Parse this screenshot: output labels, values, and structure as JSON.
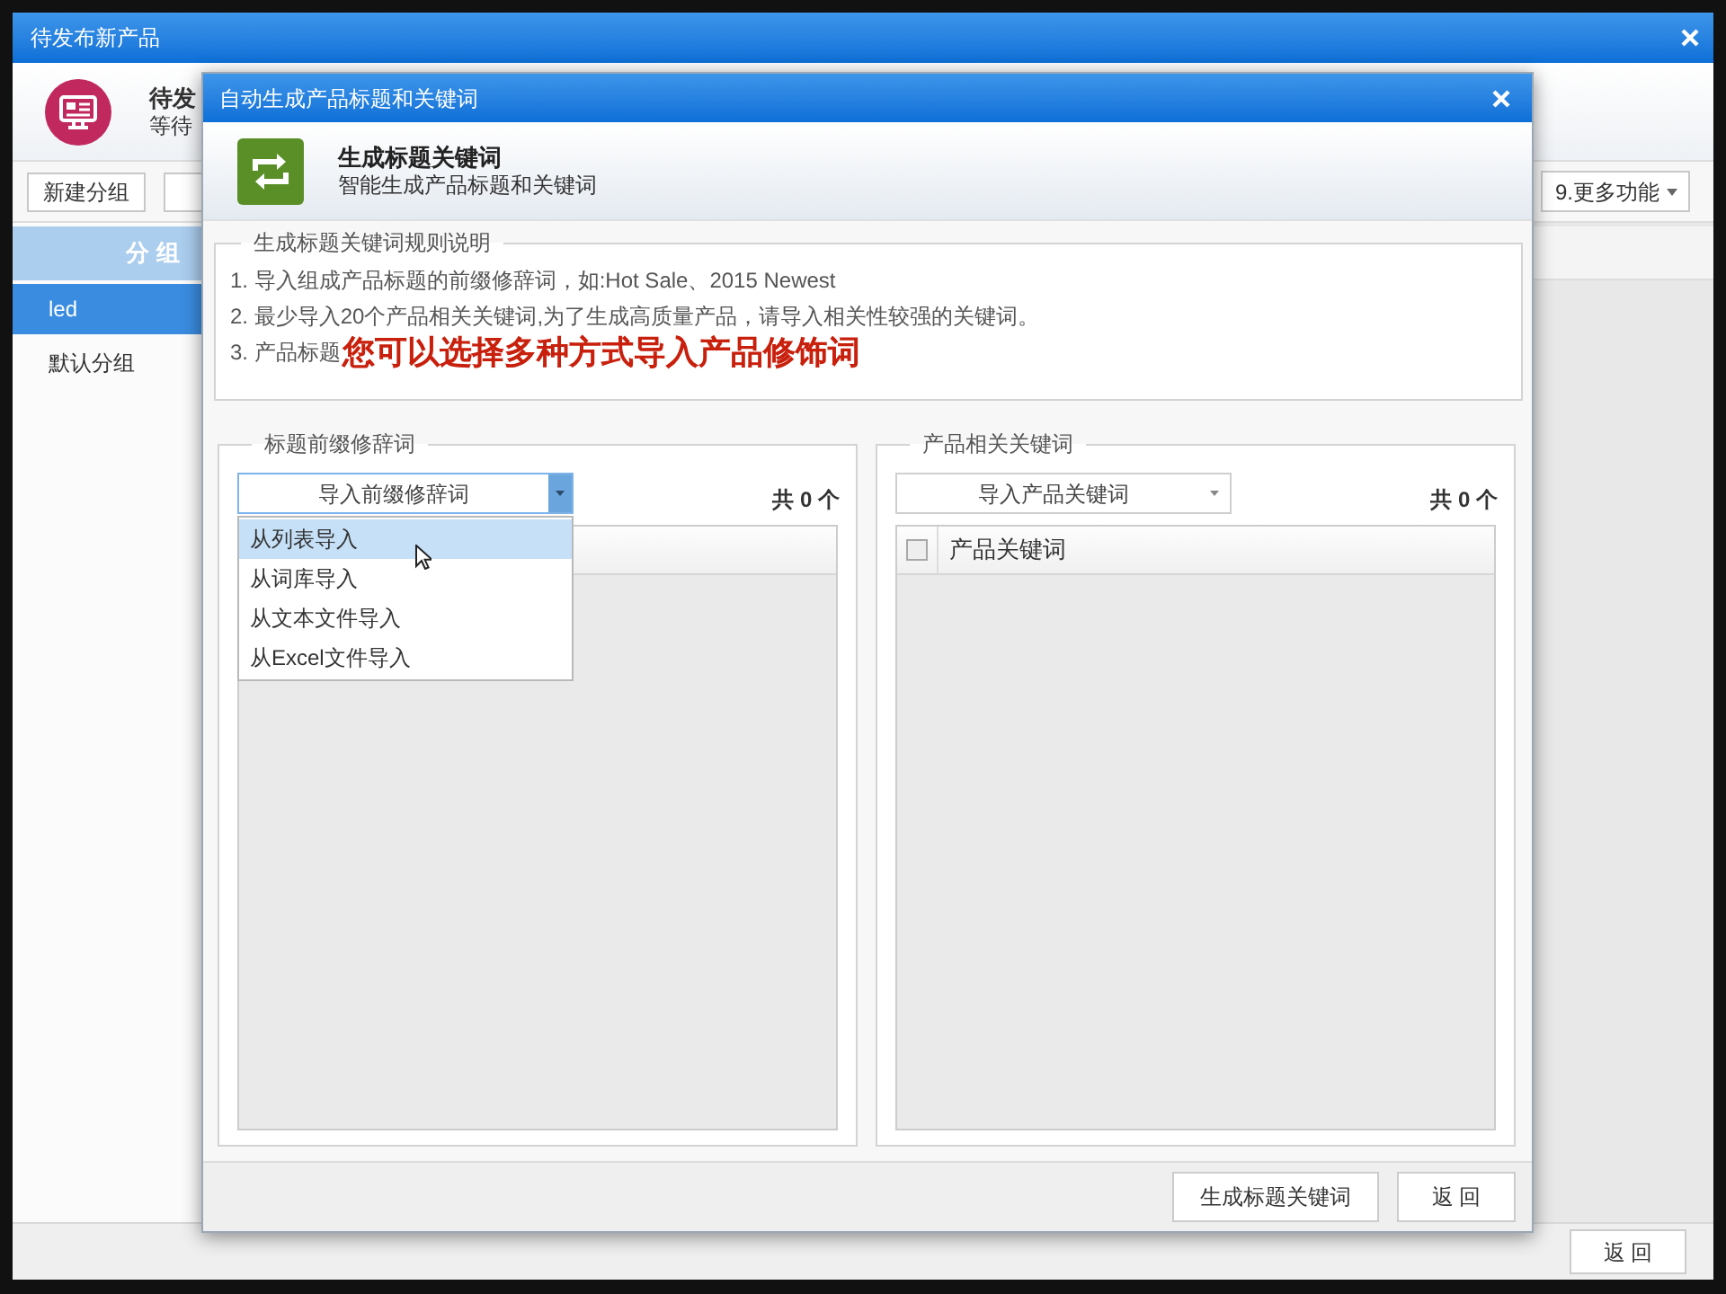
{
  "window": {
    "title": "待发布新产品"
  },
  "page_header": {
    "title": "待发",
    "subtitle": "等待"
  },
  "toolbar": {
    "buttons": [
      "新建分组"
    ],
    "more_menu": "9.更多功能"
  },
  "groups": {
    "heading": "分 组",
    "items": [
      {
        "label": "led",
        "selected": true
      },
      {
        "label": "默认分组",
        "selected": false
      }
    ]
  },
  "back_button": "返 回",
  "dialog": {
    "title": "自动生成产品标题和关键词",
    "heading": {
      "title": "生成标题关键词",
      "subtitle": "智能生成产品标题和关键词"
    },
    "rules": {
      "legend": "生成标题关键词规则说明",
      "lines": [
        "1. 导入组成产品标题的前缀修辞词，如:Hot Sale、2015 Newest",
        "2. 最少导入20个产品相关关键词,为了生成高质量产品，请导入相关性较强的关键词。",
        "3. 产品标题"
      ],
      "caption": "您可以选择多种方式导入产品修饰词"
    },
    "panels": [
      {
        "legend": "标题前缀修辞词",
        "dropdown": {
          "label": "导入前缀修辞词",
          "expanded": true,
          "options": [
            {
              "label": "从列表导入",
              "highlighted": true
            },
            {
              "label": "从词库导入",
              "highlighted": false
            },
            {
              "label": "从文本文件导入",
              "highlighted": false
            },
            {
              "label": "从Excel文件导入",
              "highlighted": false
            }
          ]
        },
        "count": "共 0 个"
      },
      {
        "legend": "产品相关关键词",
        "dropdown": {
          "label": "导入产品关键词",
          "expanded": false
        },
        "count": "共 0 个",
        "column": {
          "label": "产品关键词",
          "checked": false
        }
      }
    ],
    "buttons": [
      "生成标题关键词",
      "返 回"
    ]
  }
}
